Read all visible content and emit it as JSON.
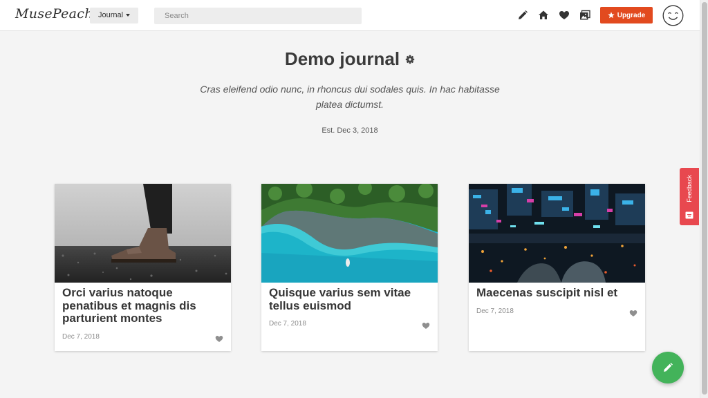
{
  "header": {
    "logo": "MusePeach",
    "journal_dropdown": "Journal",
    "search": {
      "placeholder": "Search",
      "value": ""
    },
    "icons": [
      "pencil-icon",
      "home-icon",
      "heart-icon",
      "gallery-icon"
    ],
    "upgrade_label": "Upgrade",
    "avatar_icon": "smiley-face-icon"
  },
  "journal": {
    "title": "Demo journal",
    "description": "Cras eleifend odio nunc, in rhoncus dui sodales quis. In hac habitasse platea dictumst.",
    "established": "Est. Dec 3, 2018"
  },
  "posts": [
    {
      "title": "Orci varius natoque penatibus et magnis dis parturient montes",
      "date": "Dec 7, 2018",
      "image": "boot-on-gravel-photo"
    },
    {
      "title": "Quisque varius sem vitae tellus euismod",
      "date": "Dec 7, 2018",
      "image": "aerial-coast-photo"
    },
    {
      "title": "Maecenas suscipit nisl et",
      "date": "Dec 7, 2018",
      "image": "night-city-aerial-photo"
    }
  ],
  "feedback_label": "Feedback",
  "colors": {
    "upgrade": "#e24a1f",
    "feedback": "#e8484f",
    "fab": "#43b35a",
    "background": "#f4f4f4"
  }
}
